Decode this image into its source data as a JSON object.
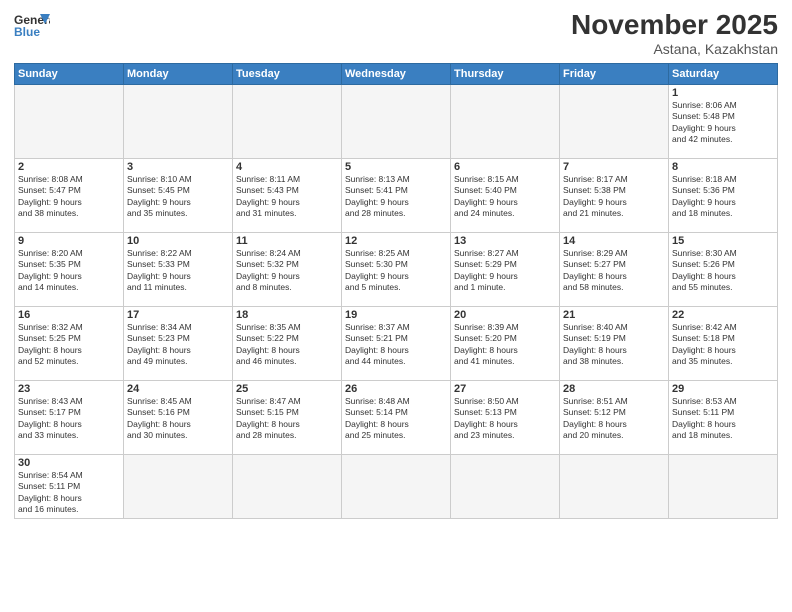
{
  "logo": {
    "line1": "General",
    "line2": "Blue"
  },
  "title": "November 2025",
  "subtitle": "Astana, Kazakhstan",
  "weekdays": [
    "Sunday",
    "Monday",
    "Tuesday",
    "Wednesday",
    "Thursday",
    "Friday",
    "Saturday"
  ],
  "days": [
    {
      "date": "",
      "info": ""
    },
    {
      "date": "",
      "info": ""
    },
    {
      "date": "",
      "info": ""
    },
    {
      "date": "",
      "info": ""
    },
    {
      "date": "",
      "info": ""
    },
    {
      "date": "",
      "info": ""
    },
    {
      "date": "1",
      "info": "Sunrise: 8:06 AM\nSunset: 5:48 PM\nDaylight: 9 hours\nand 42 minutes."
    },
    {
      "date": "2",
      "info": "Sunrise: 8:08 AM\nSunset: 5:47 PM\nDaylight: 9 hours\nand 38 minutes."
    },
    {
      "date": "3",
      "info": "Sunrise: 8:10 AM\nSunset: 5:45 PM\nDaylight: 9 hours\nand 35 minutes."
    },
    {
      "date": "4",
      "info": "Sunrise: 8:11 AM\nSunset: 5:43 PM\nDaylight: 9 hours\nand 31 minutes."
    },
    {
      "date": "5",
      "info": "Sunrise: 8:13 AM\nSunset: 5:41 PM\nDaylight: 9 hours\nand 28 minutes."
    },
    {
      "date": "6",
      "info": "Sunrise: 8:15 AM\nSunset: 5:40 PM\nDaylight: 9 hours\nand 24 minutes."
    },
    {
      "date": "7",
      "info": "Sunrise: 8:17 AM\nSunset: 5:38 PM\nDaylight: 9 hours\nand 21 minutes."
    },
    {
      "date": "8",
      "info": "Sunrise: 8:18 AM\nSunset: 5:36 PM\nDaylight: 9 hours\nand 18 minutes."
    },
    {
      "date": "9",
      "info": "Sunrise: 8:20 AM\nSunset: 5:35 PM\nDaylight: 9 hours\nand 14 minutes."
    },
    {
      "date": "10",
      "info": "Sunrise: 8:22 AM\nSunset: 5:33 PM\nDaylight: 9 hours\nand 11 minutes."
    },
    {
      "date": "11",
      "info": "Sunrise: 8:24 AM\nSunset: 5:32 PM\nDaylight: 9 hours\nand 8 minutes."
    },
    {
      "date": "12",
      "info": "Sunrise: 8:25 AM\nSunset: 5:30 PM\nDaylight: 9 hours\nand 5 minutes."
    },
    {
      "date": "13",
      "info": "Sunrise: 8:27 AM\nSunset: 5:29 PM\nDaylight: 9 hours\nand 1 minute."
    },
    {
      "date": "14",
      "info": "Sunrise: 8:29 AM\nSunset: 5:27 PM\nDaylight: 8 hours\nand 58 minutes."
    },
    {
      "date": "15",
      "info": "Sunrise: 8:30 AM\nSunset: 5:26 PM\nDaylight: 8 hours\nand 55 minutes."
    },
    {
      "date": "16",
      "info": "Sunrise: 8:32 AM\nSunset: 5:25 PM\nDaylight: 8 hours\nand 52 minutes."
    },
    {
      "date": "17",
      "info": "Sunrise: 8:34 AM\nSunset: 5:23 PM\nDaylight: 8 hours\nand 49 minutes."
    },
    {
      "date": "18",
      "info": "Sunrise: 8:35 AM\nSunset: 5:22 PM\nDaylight: 8 hours\nand 46 minutes."
    },
    {
      "date": "19",
      "info": "Sunrise: 8:37 AM\nSunset: 5:21 PM\nDaylight: 8 hours\nand 44 minutes."
    },
    {
      "date": "20",
      "info": "Sunrise: 8:39 AM\nSunset: 5:20 PM\nDaylight: 8 hours\nand 41 minutes."
    },
    {
      "date": "21",
      "info": "Sunrise: 8:40 AM\nSunset: 5:19 PM\nDaylight: 8 hours\nand 38 minutes."
    },
    {
      "date": "22",
      "info": "Sunrise: 8:42 AM\nSunset: 5:18 PM\nDaylight: 8 hours\nand 35 minutes."
    },
    {
      "date": "23",
      "info": "Sunrise: 8:43 AM\nSunset: 5:17 PM\nDaylight: 8 hours\nand 33 minutes."
    },
    {
      "date": "24",
      "info": "Sunrise: 8:45 AM\nSunset: 5:16 PM\nDaylight: 8 hours\nand 30 minutes."
    },
    {
      "date": "25",
      "info": "Sunrise: 8:47 AM\nSunset: 5:15 PM\nDaylight: 8 hours\nand 28 minutes."
    },
    {
      "date": "26",
      "info": "Sunrise: 8:48 AM\nSunset: 5:14 PM\nDaylight: 8 hours\nand 25 minutes."
    },
    {
      "date": "27",
      "info": "Sunrise: 8:50 AM\nSunset: 5:13 PM\nDaylight: 8 hours\nand 23 minutes."
    },
    {
      "date": "28",
      "info": "Sunrise: 8:51 AM\nSunset: 5:12 PM\nDaylight: 8 hours\nand 20 minutes."
    },
    {
      "date": "29",
      "info": "Sunrise: 8:53 AM\nSunset: 5:11 PM\nDaylight: 8 hours\nand 18 minutes."
    },
    {
      "date": "30",
      "info": "Sunrise: 8:54 AM\nSunset: 5:11 PM\nDaylight: 8 hours\nand 16 minutes."
    },
    {
      "date": "",
      "info": ""
    },
    {
      "date": "",
      "info": ""
    },
    {
      "date": "",
      "info": ""
    },
    {
      "date": "",
      "info": ""
    },
    {
      "date": "",
      "info": ""
    },
    {
      "date": "",
      "info": ""
    }
  ]
}
